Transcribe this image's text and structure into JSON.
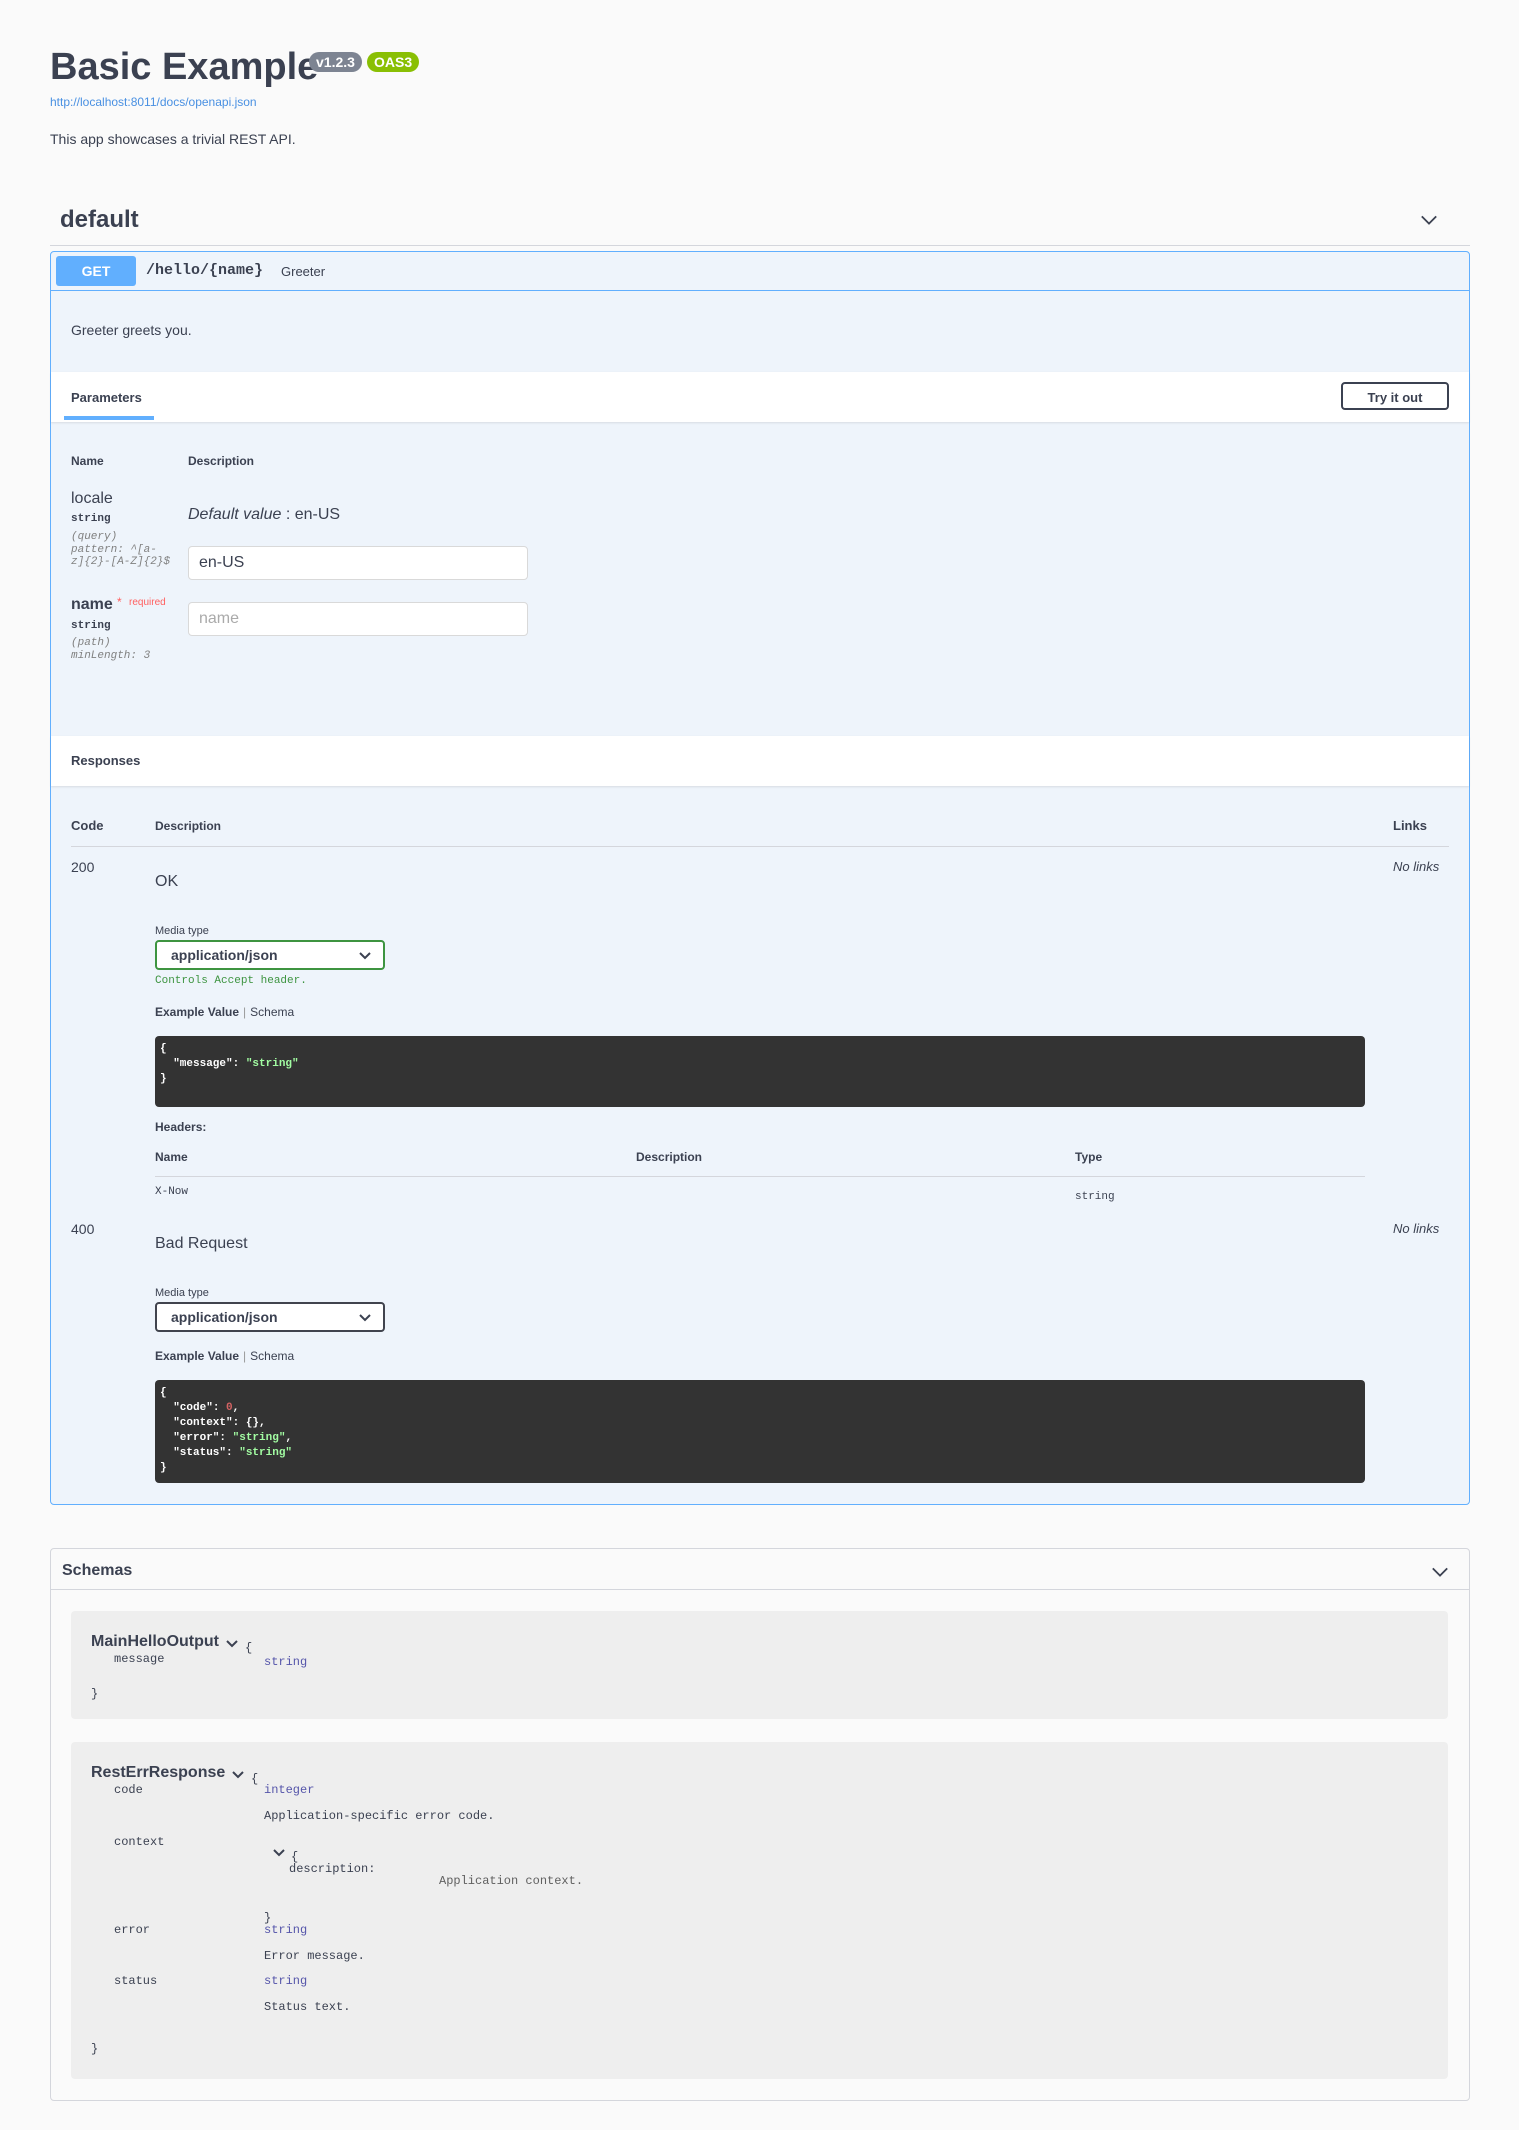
{
  "info": {
    "title": "Basic Example",
    "version": "v1.2.3",
    "oas": "OAS3",
    "spec_url": "http://localhost:8011/docs/openapi.json",
    "description": "This app showcases a trivial REST API."
  },
  "tag": {
    "name": "default"
  },
  "operation": {
    "method": "GET",
    "path": "/hello/{name}",
    "summary": "Greeter",
    "description": "Greeter greets you.",
    "params_tab": "Parameters",
    "try_label": "Try it out",
    "param_col_name": "Name",
    "param_col_desc": "Description",
    "params": [
      {
        "name": "locale",
        "type": "string",
        "in": "(query)",
        "pattern_1": "pattern: ^[a-",
        "pattern_2": "z]{2}-[A-Z]{2}$",
        "default_label": "Default value",
        "default_value": ": en-US",
        "value": "en-US",
        "placeholder": ""
      },
      {
        "name": "name",
        "required_mark": "*",
        "required_label": "required",
        "type": "string",
        "in": "(path)",
        "min_length": "minLength: 3",
        "value": "",
        "placeholder": "name"
      }
    ],
    "responses_title": "Responses",
    "resp_cols": {
      "code": "Code",
      "description": "Description",
      "links": "Links"
    },
    "responses": [
      {
        "code": "200",
        "description": "OK",
        "links": "No links",
        "media_label": "Media type",
        "media_type": "application/json",
        "controls": "Controls Accept header.",
        "tab_example": "Example Value",
        "tab_sep": "|",
        "tab_schema": "Schema",
        "example": {
          "open": "{",
          "l1_key": "\"message\"",
          "l1_colon": ": ",
          "l1_val": "\"string\"",
          "close": "}"
        },
        "headers_label": "Headers:",
        "headers_cols": {
          "name": "Name",
          "description": "Description",
          "type": "Type"
        },
        "header_row": {
          "name": "X-Now",
          "type": "string"
        }
      },
      {
        "code": "400",
        "description": "Bad Request",
        "links": "No links",
        "media_label": "Media type",
        "media_type": "application/json",
        "tab_example": "Example Value",
        "tab_sep": "|",
        "tab_schema": "Schema",
        "example": {
          "open": "{",
          "k1": "\"code\"",
          "v1": "0",
          "c1": ",",
          "k2": "\"context\"",
          "v2": "{}",
          "c2": ",",
          "k3": "\"error\"",
          "v3": "\"string\"",
          "c3": ",",
          "k4": "\"status\"",
          "v4": "\"string\"",
          "close": "}"
        }
      }
    ]
  },
  "schemas": {
    "title": "Schemas",
    "models": [
      {
        "name": "MainHelloOutput",
        "open": "{",
        "close": "}",
        "props": [
          {
            "name": "message",
            "type": "string"
          }
        ]
      },
      {
        "name": "RestErrResponse",
        "open": "{",
        "close": "}",
        "props": [
          {
            "name": "code",
            "type": "integer",
            "desc": "Application-specific error code."
          },
          {
            "name": "context",
            "open": "{",
            "sub_key": "description:",
            "sub_desc": "Application context.",
            "close": "}"
          },
          {
            "name": "error",
            "type": "string",
            "desc": "Error message."
          },
          {
            "name": "status",
            "type": "string",
            "desc": "Status text."
          }
        ]
      }
    ]
  },
  "colors": {
    "get": "#61affe",
    "oas": "#89bf04",
    "version": "#7d8492",
    "code_bg": "#333333"
  }
}
